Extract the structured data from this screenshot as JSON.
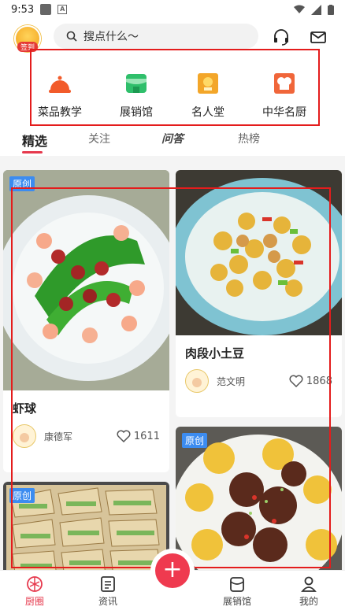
{
  "status_bar": {
    "time": "9:53"
  },
  "header": {
    "signin_label": "签到",
    "search_placeholder": "搜点什么～"
  },
  "shortcuts": [
    {
      "label": "菜品教学",
      "icon": "cloche-icon",
      "color": "#f25b2a"
    },
    {
      "label": "展销馆",
      "icon": "storefront-icon",
      "color": "#2fbf6b"
    },
    {
      "label": "名人堂",
      "icon": "medal-icon",
      "color": "#f3a629"
    },
    {
      "label": "中华名厨",
      "icon": "chef-hat-icon",
      "color": "#f0663a"
    }
  ],
  "tabs": [
    {
      "label": "精选"
    },
    {
      "label": "关注"
    },
    {
      "label": "问答"
    },
    {
      "label": "热榜"
    }
  ],
  "feed": {
    "left": [
      {
        "tag": "原创",
        "title": "虾球",
        "author": "康德军",
        "likes": "1611"
      },
      {
        "tag": "原创"
      }
    ],
    "right": [
      {
        "title": "肉段小土豆",
        "author": "范文明",
        "likes": "1868"
      },
      {
        "tag": "原创"
      }
    ]
  },
  "bottom_nav": {
    "items": [
      {
        "label": "厨圈"
      },
      {
        "label": "资讯"
      },
      {
        "label": "展销馆"
      },
      {
        "label": "我的"
      }
    ],
    "fab": "+"
  },
  "colors": {
    "accent": "#e6394d",
    "tag_blue": "#3c8cf0",
    "highlight_red": "#e41c1c"
  }
}
